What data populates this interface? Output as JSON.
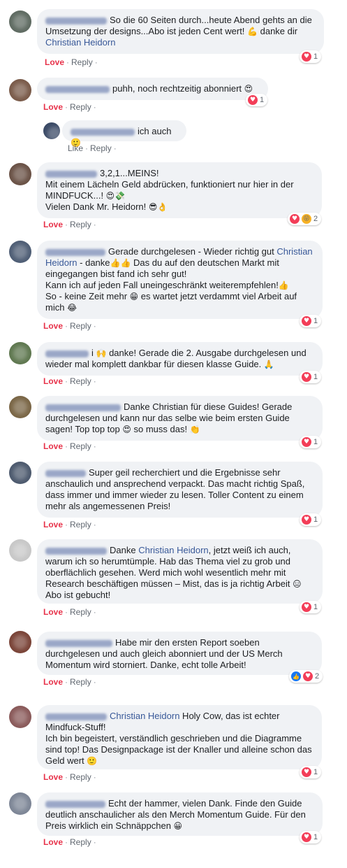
{
  "actions": {
    "love": "Love",
    "reply": "Reply",
    "like": "Like",
    "sep": "·"
  },
  "comments": [
    {
      "text_pre": "So die 60 Seiten durch...heute Abend gehts an die Umsetzung der designs...Abo ist jeden Cent wert! ",
      "emoji": "💪",
      "text_mid": " danke dir ",
      "mention": "Christian Heidorn",
      "count": "1"
    },
    {
      "text_pre": "puhh, noch rechtzeitig abonniert ",
      "emoji": "😍",
      "count": "1"
    },
    {
      "text_pre": "ich auch ",
      "emoji": "🙂"
    },
    {
      "text_pre": "3,2,1...MEINS!",
      "line2": "Mit einem Lächeln Geld abdrücken, funktioniert nur hier in der MINDFUCK...! ",
      "emoji": "😍💸",
      "line3": "Vielen Dank Mr. Heidorn! ",
      "emoji2": "😎👌",
      "count": "2"
    },
    {
      "text_pre": "Gerade durchgelesen - Wieder richtig gut ",
      "mention": "Christian Heidorn",
      "text_mid": " - danke",
      "emoji": "👍👍",
      "text_post": " Das du auf den deutschen Markt mit eingegangen bist fand ich sehr gut!",
      "line2": "Kann ich auf jeden Fall uneingeschränkt weiterempfehlen!",
      "emoji2": "👍",
      "line3": "So - keine Zeit mehr ",
      "emoji3": "😁",
      "line3b": " es wartet jetzt verdammt viel Arbeit auf mich ",
      "emoji4": "😂",
      "count": "1"
    },
    {
      "text_pre": "i ",
      "emoji": "🙌",
      "text_mid": " danke! Gerade die 2. Ausgabe durchgelesen und wieder mal komplett dankbar für diesen klasse Guide. ",
      "emoji2": "🙏",
      "count": "1"
    },
    {
      "text_pre": "Danke Christian für diese Guides! Gerade durchgelesen und kann nur das selbe wie beim ersten Guide sagen! Top top top ",
      "emoji": "😍",
      "text_mid": " so muss das! ",
      "emoji2": "👏",
      "count": "1"
    },
    {
      "text_pre": "Super geil recherchiert und die Ergebnisse sehr anschaulich und ansprechend verpackt. Das macht richtig Spaß, dass immer und immer wieder zu lesen. Toller Content zu einem mehr als angemessenen Preis!",
      "count": "1"
    },
    {
      "text_pre": "Danke ",
      "mention": "Christian Heidorn",
      "text_mid": ", jetzt weiß ich auch, warum ich so herumtümple. Hab das Thema viel zu grob und oberflächlich gesehen. Werd mich wohl wesentlich mehr mit Research beschäftigen müssen – Mist, das is ja richtig Arbeit ",
      "emoji": "😑",
      "line2": "Abo ist gebucht!",
      "count": "1"
    },
    {
      "text_pre": "Habe mir den ersten Report soeben durchgelesen und auch gleich abonniert und der US Merch Momentum wird storniert. Danke, echt tolle Arbeit!",
      "count": "2"
    },
    {
      "mention": "Christian Heidorn",
      "text_pre": " Holy Cow, das ist echter Mindfuck-Stuff!",
      "line2": "Ich bin begeistert, verständlich geschrieben und die Diagramme sind top! Das Designpackage ist der Knaller und alleine schon das Geld wert ",
      "emoji": "🙂",
      "count": "1"
    },
    {
      "text_pre": "Echt der hammer, vielen Dank. Finde den Guide deutlich anschaulicher als den Merch Momentum Guide. Für den Preis wirklich ein Schnäppchen ",
      "emoji": "😀",
      "count": "1"
    }
  ],
  "icons": {
    "reaction_love": "heart-icon",
    "reaction_like": "thumbs-up-icon",
    "reaction_haha": "laughing-icon"
  },
  "colors": {
    "love": "#e7324a",
    "link": "#385898",
    "bubble": "#f0f2f5",
    "heart": "#f33e58",
    "like": "#1877f2"
  }
}
